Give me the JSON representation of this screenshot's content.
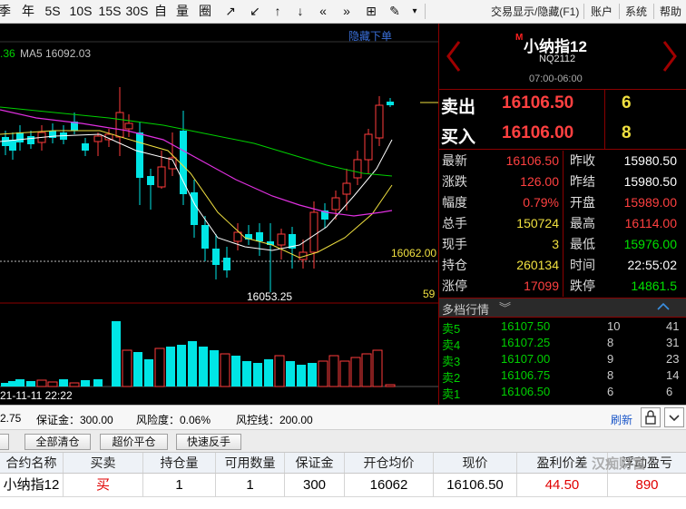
{
  "toolbar": {
    "items": [
      "季",
      "年",
      "5S",
      "10S",
      "15S",
      "30S",
      "自",
      "量",
      "圈",
      "↗",
      "↙",
      "↑",
      "↓",
      "«",
      "»",
      "⊞",
      "✎",
      "▾"
    ],
    "trade_display_toggle": "交易显示/隐藏(F1)",
    "account": "账户",
    "system": "系统",
    "help": "帮助"
  },
  "chart": {
    "hide_orders": "隐藏下单",
    "ma_prefix": ".36",
    "ma5_label": "MA5 16092.03",
    "price_line_label": "16062.00",
    "low_label": "16053.25",
    "right_tick": "59",
    "time_label": "21-11-11 22:22",
    "colors": {
      "up": "#ff3b3b",
      "down": "#00e5e5",
      "ma5": "#ffffff",
      "ma10": "#f0e040",
      "ma20": "#e030e0",
      "ma60": "#00d000"
    }
  },
  "quote": {
    "symbol": "小纳指12",
    "symbol_badge": "M",
    "code": "NQ2112",
    "session": "07:00-06:00",
    "sell_label": "卖出",
    "sell_price": "16106.50",
    "sell_qty": "6",
    "buy_label": "买入",
    "buy_price": "16106.00",
    "buy_qty": "8",
    "rows": [
      {
        "l1": "最新",
        "v1": "16106.50",
        "c1": "#ff4040",
        "l2": "昨收",
        "v2": "15980.50",
        "c2": "#ffffff"
      },
      {
        "l1": "涨跌",
        "v1": "126.00",
        "c1": "#ff4040",
        "l2": "昨结",
        "v2": "15980.50",
        "c2": "#ffffff"
      },
      {
        "l1": "幅度",
        "v1": "0.79%",
        "c1": "#ff4040",
        "l2": "开盘",
        "v2": "15989.00",
        "c2": "#ff4040"
      },
      {
        "l1": "总手",
        "v1": "150724",
        "c1": "#f0e040",
        "l2": "最高",
        "v2": "16114.00",
        "c2": "#ff4040"
      },
      {
        "l1": "现手",
        "v1": "3",
        "c1": "#f0e040",
        "l2": "最低",
        "v2": "15976.00",
        "c2": "#00e000"
      },
      {
        "l1": "持仓",
        "v1": "260134",
        "c1": "#f0e040",
        "l2": "时间",
        "v2": "22:55:02",
        "c2": "#ffffff"
      },
      {
        "l1": "涨停",
        "v1": "17099",
        "c1": "#ff4040",
        "l2": "跌停",
        "v2": "14861.5",
        "c2": "#00e000"
      }
    ],
    "depth_title": "多档行情",
    "depth": [
      {
        "label": "卖5",
        "price": "16107.50",
        "qty": "10",
        "count": "41"
      },
      {
        "label": "卖4",
        "price": "16107.25",
        "qty": "8",
        "count": "31"
      },
      {
        "label": "卖3",
        "price": "16107.00",
        "qty": "9",
        "count": "23"
      },
      {
        "label": "卖2",
        "price": "16106.75",
        "qty": "8",
        "count": "14"
      },
      {
        "label": "卖1",
        "price": "16106.50",
        "qty": "6",
        "count": "6"
      }
    ]
  },
  "account": {
    "balance_partial": "2.75",
    "margin": "保证金：300.00",
    "risk": "风险度：0.06%",
    "control": "风控线：200.00",
    "refresh": "刷新"
  },
  "buttons": {
    "close_all": "全部清仓",
    "close_limit": "超价平仓",
    "reverse": "快速反手"
  },
  "positions": {
    "headers": [
      "合约名称",
      "买卖",
      "持仓量",
      "可用数量",
      "保证金",
      "开仓均价",
      "现价",
      "盈利价差",
      "浮动盈亏"
    ],
    "row": [
      "小纳指12",
      "买",
      "1",
      "1",
      "300",
      "16062",
      "16106.50",
      "44.50",
      "890"
    ]
  },
  "watermark": "汉痴财富"
}
